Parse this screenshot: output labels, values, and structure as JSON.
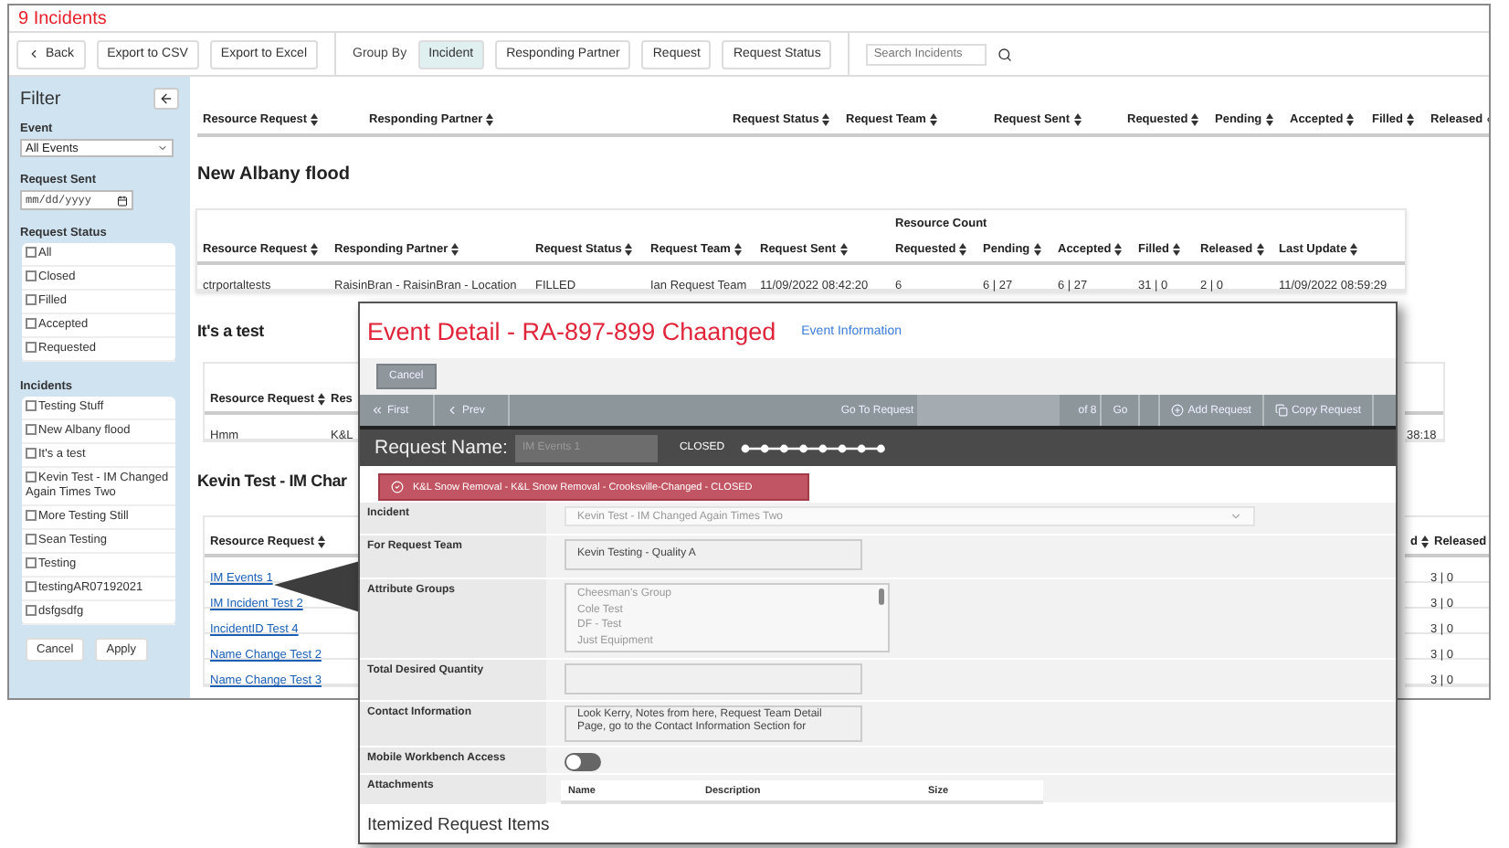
{
  "title": "9 Incidents",
  "toolbar": {
    "actions": [
      {
        "label": "Back",
        "kind": "back"
      },
      {
        "label": "Export to CSV",
        "kind": "plain"
      },
      {
        "label": "Export to Excel",
        "kind": "plain"
      }
    ],
    "group_by": {
      "label": "Group By",
      "options": [
        {
          "label": "Incident",
          "selected": true
        },
        {
          "label": "Responding Partner",
          "selected": false
        },
        {
          "label": "Request",
          "selected": false
        },
        {
          "label": "Request Status",
          "selected": false
        }
      ]
    },
    "search": {
      "placeholder": "Search Incidents"
    }
  },
  "filter": {
    "title": "Filter",
    "event": {
      "label": "Event",
      "value": "All Events"
    },
    "request_sent": {
      "label": "Request Sent",
      "placeholder": "mm/dd/yyyy"
    },
    "request_status": {
      "label": "Request Status",
      "options": [
        {
          "label": "All",
          "checked": false
        },
        {
          "label": "Closed",
          "checked": false
        },
        {
          "label": "Filled",
          "checked": false
        },
        {
          "label": "Accepted",
          "checked": false
        },
        {
          "label": "Requested",
          "checked": false
        }
      ]
    },
    "incidents": {
      "label": "Incidents",
      "options": [
        {
          "label": "Testing Stuff",
          "checked": false
        },
        {
          "label": "New Albany flood",
          "checked": false
        },
        {
          "label": "It's a test",
          "checked": false
        },
        {
          "label": "Kevin Test - IM Changed Again Times Two",
          "checked": false
        },
        {
          "label": "More Testing Still",
          "checked": false
        },
        {
          "label": "Sean Testing",
          "checked": false
        },
        {
          "label": "Testing",
          "checked": false
        },
        {
          "label": "testingAR07192021",
          "checked": false
        },
        {
          "label": "dsfgsdfg",
          "checked": false
        }
      ]
    },
    "buttons": [
      "Cancel",
      "Apply"
    ]
  },
  "summary_columns": [
    "Resource Request",
    "Responding Partner",
    "Request Status",
    "Request Team",
    "Request Sent",
    "Requested",
    "Pending",
    "Accepted",
    "Filled",
    "Released"
  ],
  "groups": [
    {
      "title": "New Albany flood",
      "column_group": "Resource Count",
      "columns": [
        "Resource Request",
        "Responding Partner",
        "Request Status",
        "Request Team",
        "Request Sent",
        "Requested",
        "Pending",
        "Accepted",
        "Filled",
        "Released",
        "Last Update"
      ],
      "rows": [
        [
          "ctrportaltests",
          "RaisinBran - RaisinBran - Location",
          "FILLED",
          "Ian Request Team",
          "11/09/2022 08:42:20",
          "6",
          "6 | 27",
          "6 | 27",
          "31 | 0",
          "2 | 0",
          "11/09/2022 08:59:29"
        ]
      ]
    }
  ],
  "partial_groups": [
    {
      "title": "It's a test",
      "links": false,
      "left_columns": [
        "Resource Request",
        "Res"
      ],
      "left_rows": [
        [
          "Hmm",
          "K&L"
        ]
      ],
      "right_rows": [
        [
          "38:18"
        ]
      ]
    },
    {
      "title": "Kevin Test - IM Char",
      "links": true,
      "left_columns": [
        "Resource Request"
      ],
      "left_rows": [
        [
          "IM Events 1"
        ],
        [
          "IM Incident Test 2"
        ],
        [
          "IncidentID Test 4"
        ],
        [
          "Name Change Test 2"
        ],
        [
          "Name Change Test 3"
        ]
      ],
      "right_columns": [
        "d",
        "Released"
      ],
      "right_rows": [
        [
          "3 | 0"
        ],
        [
          "3 | 0"
        ],
        [
          "3 | 0"
        ],
        [
          "3 | 0"
        ],
        [
          "3 | 0"
        ]
      ]
    }
  ],
  "detail": {
    "title": "Event Detail - RA-897-899 Chaanged",
    "link": "Event Information",
    "cancel": "Cancel",
    "nav": {
      "first": "First",
      "prev": "Prev",
      "goto_label": "Go To Request",
      "of": "of 8",
      "go": "Go",
      "add": "Add Request",
      "copy": "Copy Request"
    },
    "request_name": {
      "label": "Request Name:",
      "value": "IM Events 1",
      "status": "CLOSED"
    },
    "banner": "K&L Snow Removal - K&L Snow Removal - Crooksville-Changed - CLOSED",
    "fields": [
      {
        "label": "Incident",
        "kind": "select",
        "value": "Kevin Test - IM Changed Again Times Two"
      },
      {
        "label": "For Request Team",
        "kind": "text",
        "value": "Kevin Testing - Quality A"
      },
      {
        "label": "Attribute Groups",
        "kind": "list",
        "options": [
          "Cheesman's Group",
          "Cole Test",
          "DF - Test",
          "Just Equipment"
        ]
      },
      {
        "label": "Total Desired Quantity",
        "kind": "text"
      },
      {
        "label": "Contact Information",
        "kind": "textarea",
        "value": "Look Kerry, Notes from here, Request Team Detail Page, go to the Contact Information Section for"
      },
      {
        "label": "Mobile Workbench Access",
        "kind": "toggle",
        "on": false
      },
      {
        "label": "Attachments",
        "kind": "table",
        "columns": [
          "Name",
          "Description",
          "Size"
        ]
      }
    ],
    "items_heading": "Itemized Request Items"
  }
}
